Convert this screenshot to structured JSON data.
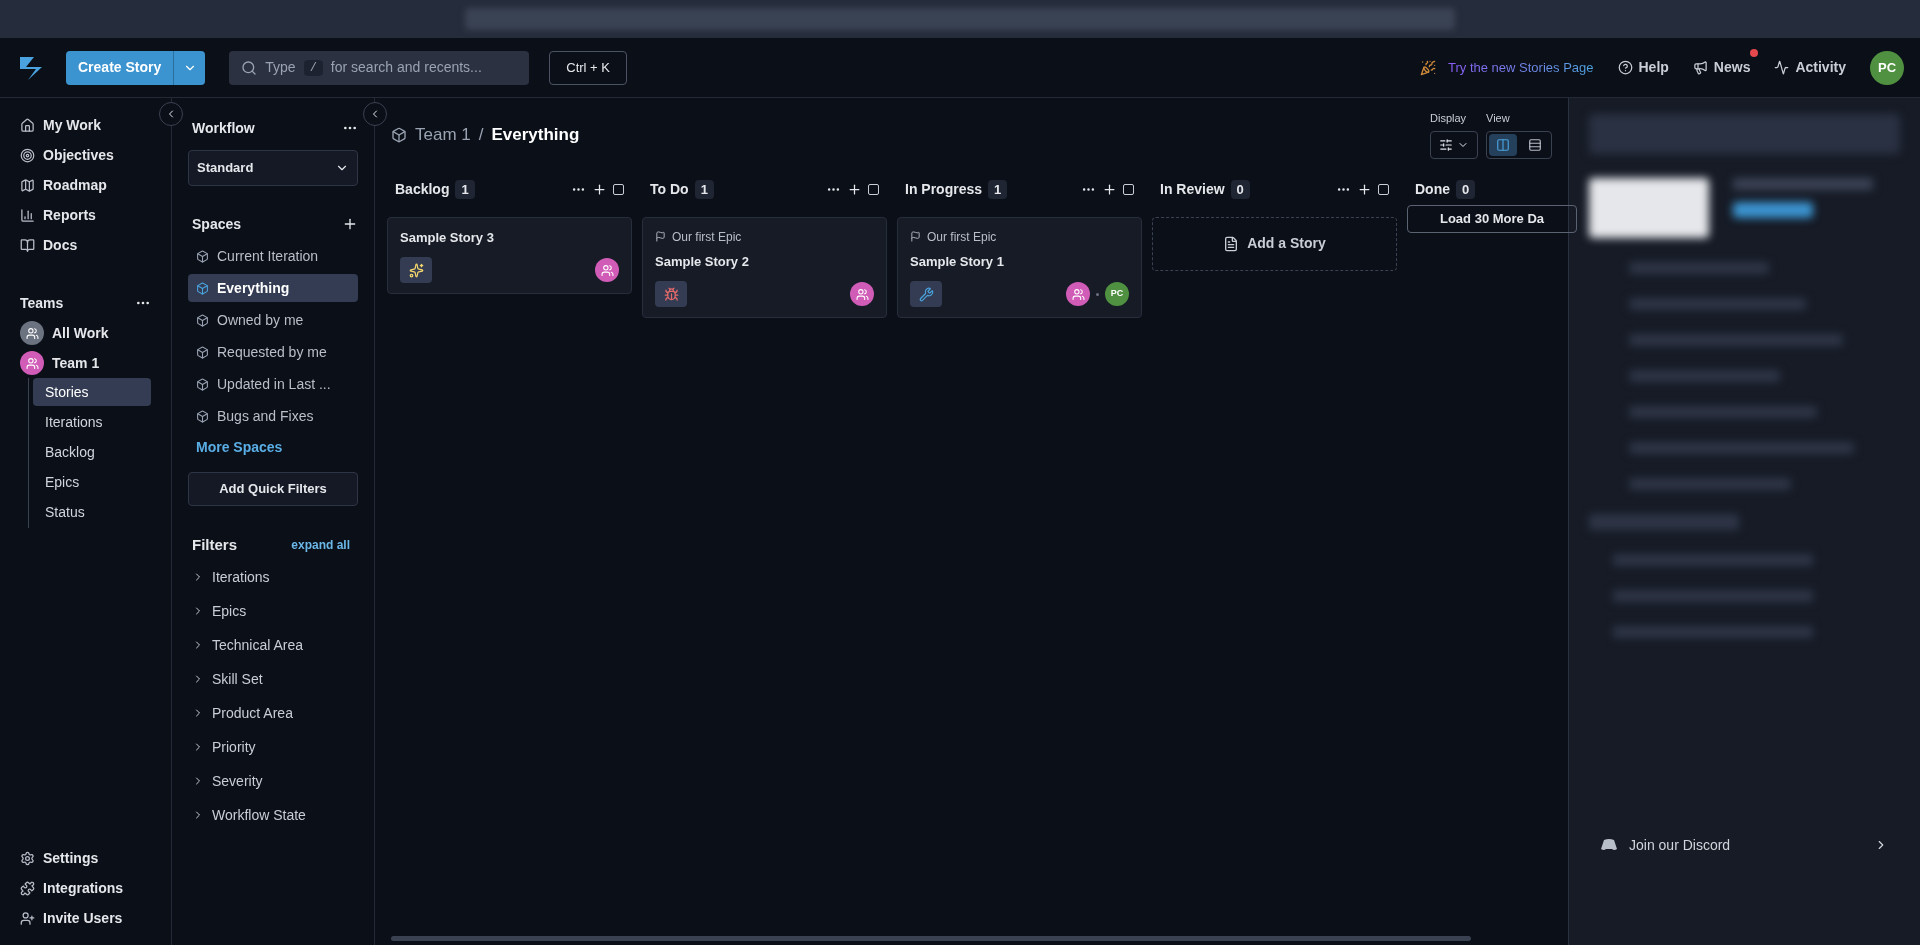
{
  "header": {
    "create_button": "Create Story",
    "search": {
      "prefix": "Type",
      "key": "/",
      "placeholder": "for search and recents..."
    },
    "shortcut": "Ctrl + K",
    "promo": "Try the new Stories Page",
    "links": [
      {
        "kind": "help",
        "label": "Help",
        "badge": false
      },
      {
        "kind": "news",
        "label": "News",
        "badge": true
      },
      {
        "kind": "activity",
        "label": "Activity",
        "badge": false
      }
    ],
    "avatar": "PC"
  },
  "nav": {
    "items": [
      {
        "kind": "home",
        "label": "My Work"
      },
      {
        "kind": "target",
        "label": "Objectives"
      },
      {
        "kind": "road",
        "label": "Roadmap"
      },
      {
        "kind": "chart",
        "label": "Reports"
      },
      {
        "kind": "book",
        "label": "Docs"
      }
    ],
    "teams_title": "Teams",
    "teams": [
      {
        "label": "All Work",
        "color": "#6b7280"
      },
      {
        "label": "Team 1",
        "color": "#d05cb8"
      }
    ],
    "team_items": [
      {
        "label": "Stories",
        "selected": true
      },
      {
        "label": "Iterations",
        "selected": false
      },
      {
        "label": "Backlog",
        "selected": false
      },
      {
        "label": "Epics",
        "selected": false
      },
      {
        "label": "Status",
        "selected": false
      }
    ],
    "bottom": [
      {
        "kind": "gear",
        "label": "Settings"
      },
      {
        "kind": "puzzle",
        "label": "Integrations"
      },
      {
        "kind": "user-plus",
        "label": "Invite Users"
      }
    ]
  },
  "spaces_panel": {
    "workflow_title": "Workflow",
    "workflow_value": "Standard",
    "spaces_title": "Spaces",
    "spaces": [
      {
        "label": "Current Iteration",
        "selected": false
      },
      {
        "label": "Everything",
        "selected": true
      },
      {
        "label": "Owned by me",
        "selected": false
      },
      {
        "label": "Requested by me",
        "selected": false
      },
      {
        "label": "Updated in Last ...",
        "selected": false
      },
      {
        "label": "Bugs and Fixes",
        "selected": false
      }
    ],
    "more": "More Spaces",
    "quick_filters": "Add Quick Filters",
    "filters_title": "Filters",
    "expand_all": "expand all",
    "filters": [
      "Iterations",
      "Epics",
      "Technical Area",
      "Skill Set",
      "Product Area",
      "Priority",
      "Severity",
      "Workflow State"
    ]
  },
  "board": {
    "breadcrumb": {
      "team": "Team 1",
      "separator": "/",
      "space": "Everything"
    },
    "display_label": "Display",
    "view_label": "View",
    "views": [
      {
        "kind": "board",
        "selected": true
      },
      {
        "kind": "list",
        "selected": false
      }
    ],
    "columns": [
      {
        "name": "Backlog",
        "count": "1",
        "controls": true,
        "checked": false,
        "cards": [
          {
            "title": "Sample Story 3",
            "kind": "feature",
            "owners": [
              {
                "kind": "team"
              }
            ]
          }
        ]
      },
      {
        "name": "To Do",
        "count": "1",
        "controls": true,
        "checked": false,
        "cards": [
          {
            "epic": "Our first Epic",
            "title": "Sample Story 2",
            "kind": "bug",
            "owners": [
              {
                "kind": "team"
              }
            ]
          }
        ]
      },
      {
        "name": "In Progress",
        "count": "1",
        "controls": true,
        "checked": false,
        "cards": [
          {
            "epic": "Our first Epic",
            "title": "Sample Story 1",
            "kind": "chore",
            "owners": [
              {
                "kind": "team"
              },
              {
                "kind": "user",
                "initials": "PC"
              }
            ]
          }
        ]
      },
      {
        "name": "In Review",
        "count": "0",
        "controls": true,
        "checked": false,
        "add_story": "Add a Story"
      },
      {
        "name": "Done",
        "count": "0",
        "controls": false,
        "load_more": "Load 30 More Da"
      }
    ]
  },
  "side_panel": {
    "discord": "Join our Discord"
  }
}
